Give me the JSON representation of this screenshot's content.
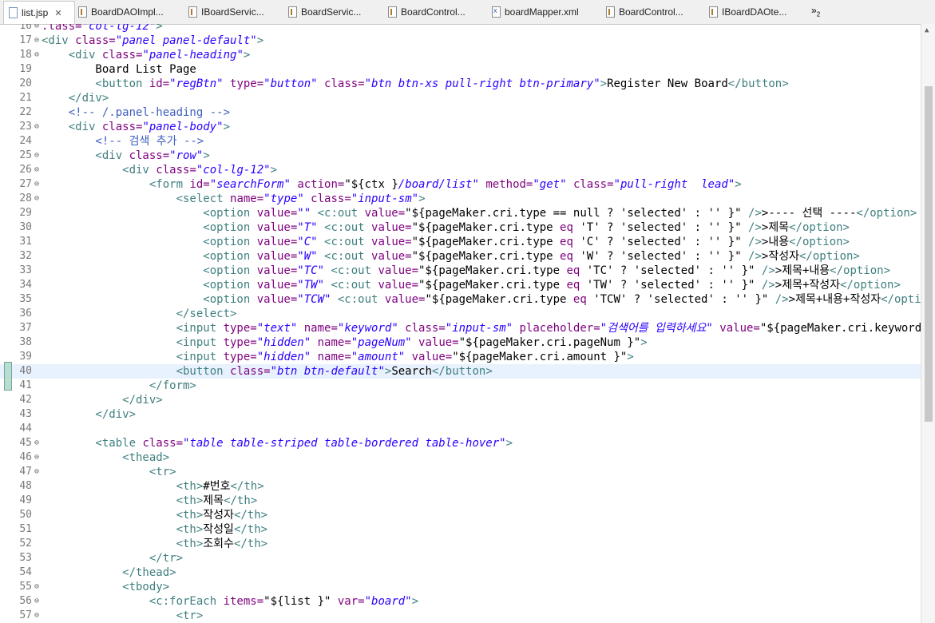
{
  "tabs": [
    {
      "label": "list.jsp",
      "icon": "jsp-file-icon",
      "active": true,
      "closable": true
    },
    {
      "label": "BoardDAOImpl...",
      "icon": "java-file-icon"
    },
    {
      "label": "IBoardServic...",
      "icon": "java-file-icon"
    },
    {
      "label": "BoardServic...",
      "icon": "java-file-icon"
    },
    {
      "label": "BoardControl...",
      "icon": "java-file-icon"
    },
    {
      "label": "boardMapper.xml",
      "icon": "xml-file-icon"
    },
    {
      "label": "BoardControl...",
      "icon": "java-file-icon"
    },
    {
      "label": "IBoardDAOte...",
      "icon": "java-file-icon"
    }
  ],
  "overflow_label": "»",
  "overflow_count": "2",
  "current_line": 40,
  "lines": [
    {
      "n": "16",
      "fold": true,
      "segs": [
        [
          "a",
          ".lass="
        ],
        [
          "v",
          "\"col-lg-12\""
        ],
        [
          "t",
          ">"
        ]
      ]
    },
    {
      "n": "17",
      "fold": true,
      "segs": [
        [
          "t",
          "<div "
        ],
        [
          "a",
          "class="
        ],
        [
          "v",
          "\"panel panel-default\""
        ],
        [
          "t",
          ">"
        ]
      ]
    },
    {
      "n": "18",
      "fold": true,
      "segs": [
        [
          "t",
          "    <div "
        ],
        [
          "a",
          "class="
        ],
        [
          "v",
          "\"panel-heading\""
        ],
        [
          "t",
          ">"
        ]
      ]
    },
    {
      "n": "19",
      "segs": [
        [
          "txt",
          "        Board List Page"
        ]
      ]
    },
    {
      "n": "20",
      "segs": [
        [
          "t",
          "        <button "
        ],
        [
          "a",
          "id="
        ],
        [
          "v",
          "\"regBtn\""
        ],
        [
          "a",
          " type="
        ],
        [
          "v",
          "\"button\""
        ],
        [
          "a",
          " class="
        ],
        [
          "v",
          "\"btn btn-xs pull-right btn-primary\""
        ],
        [
          "t",
          ">"
        ],
        [
          "txt",
          "Register New Board"
        ],
        [
          "t",
          "</button>"
        ]
      ]
    },
    {
      "n": "21",
      "segs": [
        [
          "t",
          "    </div>"
        ]
      ]
    },
    {
      "n": "22",
      "segs": [
        [
          "c",
          "    <!-- /.panel-heading -->"
        ]
      ]
    },
    {
      "n": "23",
      "fold": true,
      "segs": [
        [
          "t",
          "    <div "
        ],
        [
          "a",
          "class="
        ],
        [
          "v",
          "\"panel-body\""
        ],
        [
          "t",
          ">"
        ]
      ]
    },
    {
      "n": "24",
      "segs": [
        [
          "c",
          "        <!-- 검색 추가 -->"
        ]
      ]
    },
    {
      "n": "25",
      "fold": true,
      "segs": [
        [
          "t",
          "        <div "
        ],
        [
          "a",
          "class="
        ],
        [
          "v",
          "\"row\""
        ],
        [
          "t",
          ">"
        ]
      ]
    },
    {
      "n": "26",
      "fold": true,
      "segs": [
        [
          "t",
          "            <div "
        ],
        [
          "a",
          "class="
        ],
        [
          "v",
          "\"col-lg-12\""
        ],
        [
          "t",
          ">"
        ]
      ]
    },
    {
      "n": "27",
      "fold": true,
      "segs": [
        [
          "t",
          "                <form "
        ],
        [
          "a",
          "id="
        ],
        [
          "v",
          "\"searchForm\""
        ],
        [
          "a",
          " action="
        ],
        [
          "txt",
          "\"${ctx }"
        ],
        [
          "v",
          "/board/list\""
        ],
        [
          "a",
          " method="
        ],
        [
          "v",
          "\"get\""
        ],
        [
          "a",
          " class="
        ],
        [
          "v",
          "\"pull-right  lead\""
        ],
        [
          "t",
          ">"
        ]
      ]
    },
    {
      "n": "28",
      "fold": true,
      "segs": [
        [
          "t",
          "                    <select "
        ],
        [
          "a",
          "name="
        ],
        [
          "v",
          "\"type\""
        ],
        [
          "a",
          " class="
        ],
        [
          "v",
          "\"input-sm\""
        ],
        [
          "t",
          ">"
        ]
      ]
    },
    {
      "n": "29",
      "segs": [
        [
          "t",
          "                        <option "
        ],
        [
          "a",
          "value="
        ],
        [
          "v",
          "\"\""
        ],
        [
          "t",
          " <c:out "
        ],
        [
          "a",
          "value="
        ],
        [
          "txt",
          "\"${pageMaker.cri.type == null ? 'selected' : '' }\""
        ],
        [
          "t",
          " />"
        ],
        [
          "txt",
          ">---- 선택 ----"
        ],
        [
          "t",
          "</option>"
        ]
      ]
    },
    {
      "n": "30",
      "segs": [
        [
          "t",
          "                        <option "
        ],
        [
          "a",
          "value="
        ],
        [
          "v",
          "\"T\""
        ],
        [
          "t",
          " <c:out "
        ],
        [
          "a",
          "value="
        ],
        [
          "txt",
          "\"${pageMaker.cri.type "
        ],
        [
          "a",
          "eq"
        ],
        [
          "txt",
          " 'T' ? 'selected' : '' }\""
        ],
        [
          "t",
          " />"
        ],
        [
          "txt",
          ">제목"
        ],
        [
          "t",
          "</option>"
        ]
      ]
    },
    {
      "n": "31",
      "segs": [
        [
          "t",
          "                        <option "
        ],
        [
          "a",
          "value="
        ],
        [
          "v",
          "\"C\""
        ],
        [
          "t",
          " <c:out "
        ],
        [
          "a",
          "value="
        ],
        [
          "txt",
          "\"${pageMaker.cri.type "
        ],
        [
          "a",
          "eq"
        ],
        [
          "txt",
          " 'C' ? 'selected' : '' }\""
        ],
        [
          "t",
          " />"
        ],
        [
          "txt",
          ">내용"
        ],
        [
          "t",
          "</option>"
        ]
      ]
    },
    {
      "n": "32",
      "segs": [
        [
          "t",
          "                        <option "
        ],
        [
          "a",
          "value="
        ],
        [
          "v",
          "\"W\""
        ],
        [
          "t",
          " <c:out "
        ],
        [
          "a",
          "value="
        ],
        [
          "txt",
          "\"${pageMaker.cri.type "
        ],
        [
          "a",
          "eq"
        ],
        [
          "txt",
          " 'W' ? 'selected' : '' }\""
        ],
        [
          "t",
          " />"
        ],
        [
          "txt",
          ">작성자"
        ],
        [
          "t",
          "</option>"
        ]
      ]
    },
    {
      "n": "33",
      "segs": [
        [
          "t",
          "                        <option "
        ],
        [
          "a",
          "value="
        ],
        [
          "v",
          "\"TC\""
        ],
        [
          "t",
          " <c:out "
        ],
        [
          "a",
          "value="
        ],
        [
          "txt",
          "\"${pageMaker.cri.type "
        ],
        [
          "a",
          "eq"
        ],
        [
          "txt",
          " 'TC' ? 'selected' : '' }\""
        ],
        [
          "t",
          " />"
        ],
        [
          "txt",
          ">제목+내용"
        ],
        [
          "t",
          "</option>"
        ]
      ]
    },
    {
      "n": "34",
      "segs": [
        [
          "t",
          "                        <option "
        ],
        [
          "a",
          "value="
        ],
        [
          "v",
          "\"TW\""
        ],
        [
          "t",
          " <c:out "
        ],
        [
          "a",
          "value="
        ],
        [
          "txt",
          "\"${pageMaker.cri.type "
        ],
        [
          "a",
          "eq"
        ],
        [
          "txt",
          " 'TW' ? 'selected' : '' }\""
        ],
        [
          "t",
          " />"
        ],
        [
          "txt",
          ">제목+작성자"
        ],
        [
          "t",
          "</option>"
        ]
      ]
    },
    {
      "n": "35",
      "segs": [
        [
          "t",
          "                        <option "
        ],
        [
          "a",
          "value="
        ],
        [
          "v",
          "\"TCW\""
        ],
        [
          "t",
          " <c:out "
        ],
        [
          "a",
          "value="
        ],
        [
          "txt",
          "\"${pageMaker.cri.type "
        ],
        [
          "a",
          "eq"
        ],
        [
          "txt",
          " 'TCW' ? 'selected' : '' }\""
        ],
        [
          "t",
          " />"
        ],
        [
          "txt",
          ">제목+내용+작성자"
        ],
        [
          "t",
          "</option>"
        ]
      ]
    },
    {
      "n": "36",
      "segs": [
        [
          "t",
          "                    </select>"
        ]
      ]
    },
    {
      "n": "37",
      "segs": [
        [
          "t",
          "                    <input "
        ],
        [
          "a",
          "type="
        ],
        [
          "v",
          "\"text\""
        ],
        [
          "a",
          " name="
        ],
        [
          "v",
          "\"keyword\""
        ],
        [
          "a",
          " class="
        ],
        [
          "v",
          "\"input-sm\""
        ],
        [
          "a",
          " placeholder="
        ],
        [
          "v",
          "\"검색어를 입력하세요\""
        ],
        [
          "a",
          " value="
        ],
        [
          "txt",
          "\"${pageMaker.cri.keyword }\""
        ],
        [
          "t",
          ">"
        ]
      ]
    },
    {
      "n": "38",
      "segs": [
        [
          "t",
          "                    <input "
        ],
        [
          "a",
          "type="
        ],
        [
          "v",
          "\"hidden\""
        ],
        [
          "a",
          " name="
        ],
        [
          "v",
          "\"pageNum\""
        ],
        [
          "a",
          " value="
        ],
        [
          "txt",
          "\"${pageMaker.cri.pageNum }\""
        ],
        [
          "t",
          ">"
        ]
      ]
    },
    {
      "n": "39",
      "segs": [
        [
          "t",
          "                    <input "
        ],
        [
          "a",
          "type="
        ],
        [
          "v",
          "\"hidden\""
        ],
        [
          "a",
          " name="
        ],
        [
          "v",
          "\"amount\""
        ],
        [
          "a",
          " value="
        ],
        [
          "txt",
          "\"${pageMaker.cri.amount }\""
        ],
        [
          "t",
          ">"
        ]
      ]
    },
    {
      "n": "40",
      "segs": [
        [
          "t",
          "                    <button "
        ],
        [
          "a",
          "class="
        ],
        [
          "v",
          "\"btn btn-default\""
        ],
        [
          "t",
          ">"
        ],
        [
          "txt",
          "Search"
        ],
        [
          "t",
          "</button>"
        ]
      ]
    },
    {
      "n": "41",
      "segs": [
        [
          "t",
          "                </form>"
        ]
      ]
    },
    {
      "n": "42",
      "segs": [
        [
          "t",
          "            </div>"
        ]
      ]
    },
    {
      "n": "43",
      "segs": [
        [
          "t",
          "        </div>"
        ]
      ]
    },
    {
      "n": "44",
      "segs": []
    },
    {
      "n": "45",
      "fold": true,
      "segs": [
        [
          "t",
          "        <table "
        ],
        [
          "a",
          "class="
        ],
        [
          "v",
          "\"table table-striped table-bordered table-hover\""
        ],
        [
          "t",
          ">"
        ]
      ]
    },
    {
      "n": "46",
      "fold": true,
      "segs": [
        [
          "t",
          "            <thead>"
        ]
      ]
    },
    {
      "n": "47",
      "fold": true,
      "segs": [
        [
          "t",
          "                <tr>"
        ]
      ]
    },
    {
      "n": "48",
      "segs": [
        [
          "t",
          "                    <th>"
        ],
        [
          "txt",
          "#번호"
        ],
        [
          "t",
          "</th>"
        ]
      ]
    },
    {
      "n": "49",
      "segs": [
        [
          "t",
          "                    <th>"
        ],
        [
          "txt",
          "제목"
        ],
        [
          "t",
          "</th>"
        ]
      ]
    },
    {
      "n": "50",
      "segs": [
        [
          "t",
          "                    <th>"
        ],
        [
          "txt",
          "작성자"
        ],
        [
          "t",
          "</th>"
        ]
      ]
    },
    {
      "n": "51",
      "segs": [
        [
          "t",
          "                    <th>"
        ],
        [
          "txt",
          "작성일"
        ],
        [
          "t",
          "</th>"
        ]
      ]
    },
    {
      "n": "52",
      "segs": [
        [
          "t",
          "                    <th>"
        ],
        [
          "txt",
          "조회수"
        ],
        [
          "t",
          "</th>"
        ]
      ]
    },
    {
      "n": "53",
      "segs": [
        [
          "t",
          "                </tr>"
        ]
      ]
    },
    {
      "n": "54",
      "segs": [
        [
          "t",
          "            </thead>"
        ]
      ]
    },
    {
      "n": "55",
      "fold": true,
      "segs": [
        [
          "t",
          "            <tbody>"
        ]
      ]
    },
    {
      "n": "56",
      "fold": true,
      "segs": [
        [
          "t",
          "                <c:forEach "
        ],
        [
          "a",
          "items="
        ],
        [
          "txt",
          "\"${list }\""
        ],
        [
          "a",
          " var="
        ],
        [
          "v",
          "\"board\""
        ],
        [
          "t",
          ">"
        ]
      ]
    },
    {
      "n": "57",
      "fold": true,
      "segs": [
        [
          "t",
          "                    <tr>"
        ]
      ]
    }
  ]
}
